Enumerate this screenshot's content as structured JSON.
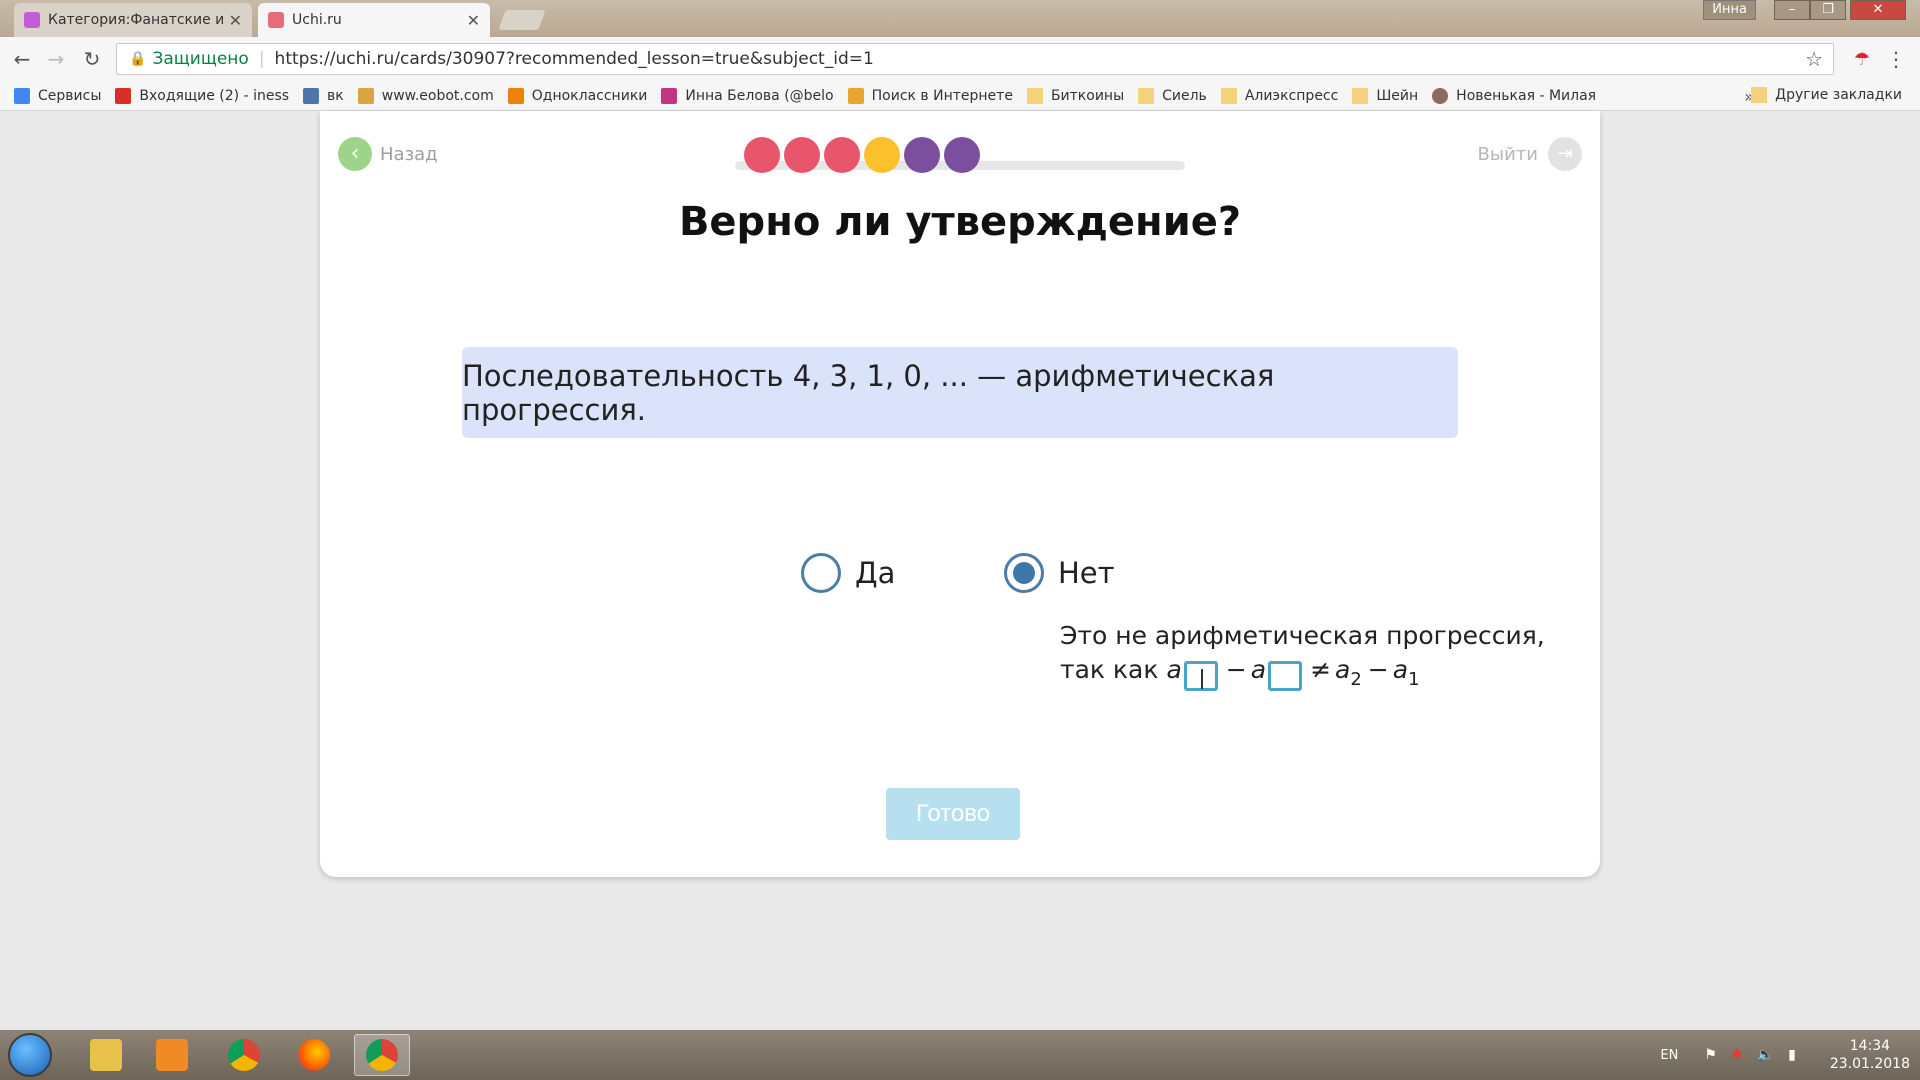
{
  "browser": {
    "tabs": [
      {
        "title": "Категория:Фанатские и",
        "favicon_color": "#c55bd6"
      },
      {
        "title": "Uchi.ru",
        "favicon_color": "#e86b7a"
      }
    ],
    "profile_name": "Инна",
    "security_label": "Защищено",
    "url": "https://uchi.ru/cards/30907?recommended_lesson=true&subject_id=1",
    "bookmarks": [
      {
        "label": "Сервисы",
        "icon": "apps-grid-icon",
        "color": "#4285f4"
      },
      {
        "label": "Входящие (2) - iness",
        "icon": "gmail-icon",
        "color": "#d93025"
      },
      {
        "label": "вк",
        "icon": "vk-icon",
        "color": "#4a76a8"
      },
      {
        "label": "www.eobot.com",
        "icon": "eobot-icon",
        "color": "#d9a441"
      },
      {
        "label": "Одноклассники",
        "icon": "ok-icon",
        "color": "#ee8208"
      },
      {
        "label": "Инна Белова (@belo",
        "icon": "instagram-icon",
        "color": "#c13584"
      },
      {
        "label": "Поиск в Интернете",
        "icon": "search-icon",
        "color": "#e8a42e"
      },
      {
        "label": "Биткоины",
        "icon": "folder-icon",
        "color": "#f5d27a"
      },
      {
        "label": "Сиель",
        "icon": "folder-icon",
        "color": "#f5d27a"
      },
      {
        "label": "Алиэкспресс",
        "icon": "folder-icon",
        "color": "#f5d27a"
      },
      {
        "label": "Шейн",
        "icon": "folder-icon",
        "color": "#f5d27a"
      },
      {
        "label": "Новенькая - Милая",
        "icon": "avatar-icon",
        "color": "#8a6b5a"
      }
    ],
    "more_label": "»",
    "other_bookmarks": "Другие закладки"
  },
  "lesson": {
    "back_label": "Назад",
    "exit_label": "Выйти",
    "progress_dots": [
      "#e8546a",
      "#e8546a",
      "#e8546a",
      "#fbc02d",
      "#7b4f9e",
      "#7b4f9e"
    ],
    "question": "Верно ли утверждение?",
    "statement": "Последовательность 4, 3, 1, 0, ... — арифметическая прогрессия.",
    "options": [
      {
        "label": "Да",
        "selected": false
      },
      {
        "label": "Нет",
        "selected": true
      }
    ],
    "explanation_line1": "Это не арифметическая прогрессия,",
    "explanation_prefix": "так как",
    "formula": {
      "a": "a",
      "minus": "−",
      "neq": "≠",
      "sub2": "2",
      "sub1": "1"
    },
    "done_label": "Готово"
  },
  "taskbar": {
    "language": "EN",
    "time": "14:34",
    "date": "23.01.2018"
  }
}
